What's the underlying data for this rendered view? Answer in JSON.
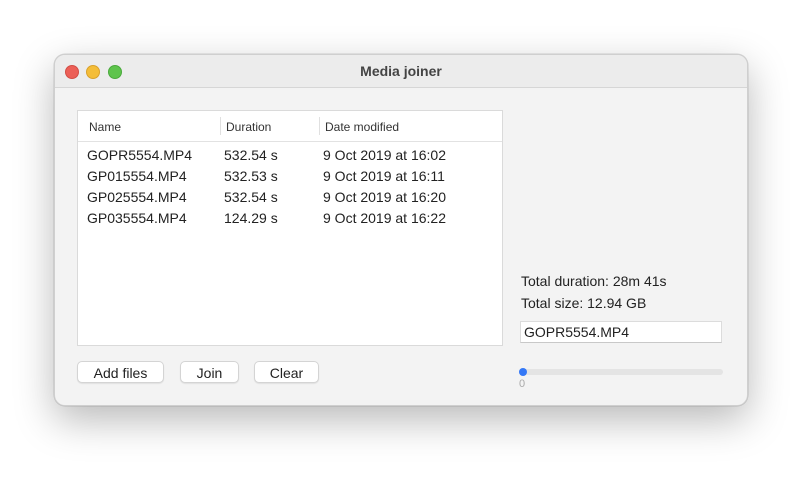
{
  "window": {
    "title": "Media joiner"
  },
  "table": {
    "columns": [
      "Name",
      "Duration",
      "Date modified"
    ],
    "rows": [
      {
        "name": "GOPR5554.MP4",
        "duration": "532.54 s",
        "date": "9 Oct 2019 at 16:02"
      },
      {
        "name": "GP015554.MP4",
        "duration": "532.53 s",
        "date": "9 Oct 2019 at 16:11"
      },
      {
        "name": "GP025554.MP4",
        "duration": "532.54 s",
        "date": "9 Oct 2019 at 16:20"
      },
      {
        "name": "GP035554.MP4",
        "duration": "124.29 s",
        "date": "9 Oct 2019 at 16:22"
      }
    ]
  },
  "buttons": {
    "add_files": "Add files",
    "join": "Join",
    "clear": "Clear"
  },
  "summary": {
    "total_duration": "Total duration: 28m 41s",
    "total_size": "Total size: 12.94 GB",
    "output_name": "GOPR5554.MP4"
  },
  "progress": {
    "value": 0,
    "label": "0",
    "accent": "#3478f6"
  }
}
